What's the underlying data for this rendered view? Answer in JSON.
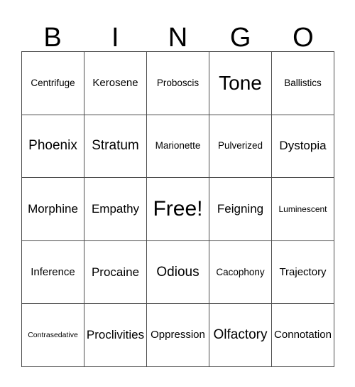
{
  "card": {
    "title": "BINGO",
    "header_letters": [
      "B",
      "I",
      "N",
      "G",
      "O"
    ],
    "colors": {
      "background": "#ffffff",
      "text": "#000000",
      "grid_line": "#4d4d4d"
    },
    "grid_size": "5x5",
    "free_space": "Free!",
    "rows": [
      [
        {
          "label": "Centrifuge",
          "size": "md"
        },
        {
          "label": "Kerosene",
          "size": "lg"
        },
        {
          "label": "Proboscis",
          "size": "md"
        },
        {
          "label": "Tone",
          "size": "huge"
        },
        {
          "label": "Ballistics",
          "size": "md"
        }
      ],
      [
        {
          "label": "Phoenix",
          "size": "xxl"
        },
        {
          "label": "Stratum",
          "size": "xxl"
        },
        {
          "label": "Marionette",
          "size": "md"
        },
        {
          "label": "Pulverized",
          "size": "md"
        },
        {
          "label": "Dystopia",
          "size": "xl"
        }
      ],
      [
        {
          "label": "Morphine",
          "size": "xl"
        },
        {
          "label": "Empathy",
          "size": "xl"
        },
        {
          "label": "Free!",
          "size": "free"
        },
        {
          "label": "Feigning",
          "size": "xl"
        },
        {
          "label": "Luminescent",
          "size": "sm"
        }
      ],
      [
        {
          "label": "Inference",
          "size": "lg"
        },
        {
          "label": "Procaine",
          "size": "xl"
        },
        {
          "label": "Odious",
          "size": "xxl"
        },
        {
          "label": "Cacophony",
          "size": "md"
        },
        {
          "label": "Trajectory",
          "size": "lg"
        }
      ],
      [
        {
          "label": "Contrasedative",
          "size": "xs"
        },
        {
          "label": "Proclivities",
          "size": "xl"
        },
        {
          "label": "Oppression",
          "size": "lg"
        },
        {
          "label": "Olfactory",
          "size": "xxl"
        },
        {
          "label": "Connotation",
          "size": "lg"
        }
      ]
    ]
  }
}
